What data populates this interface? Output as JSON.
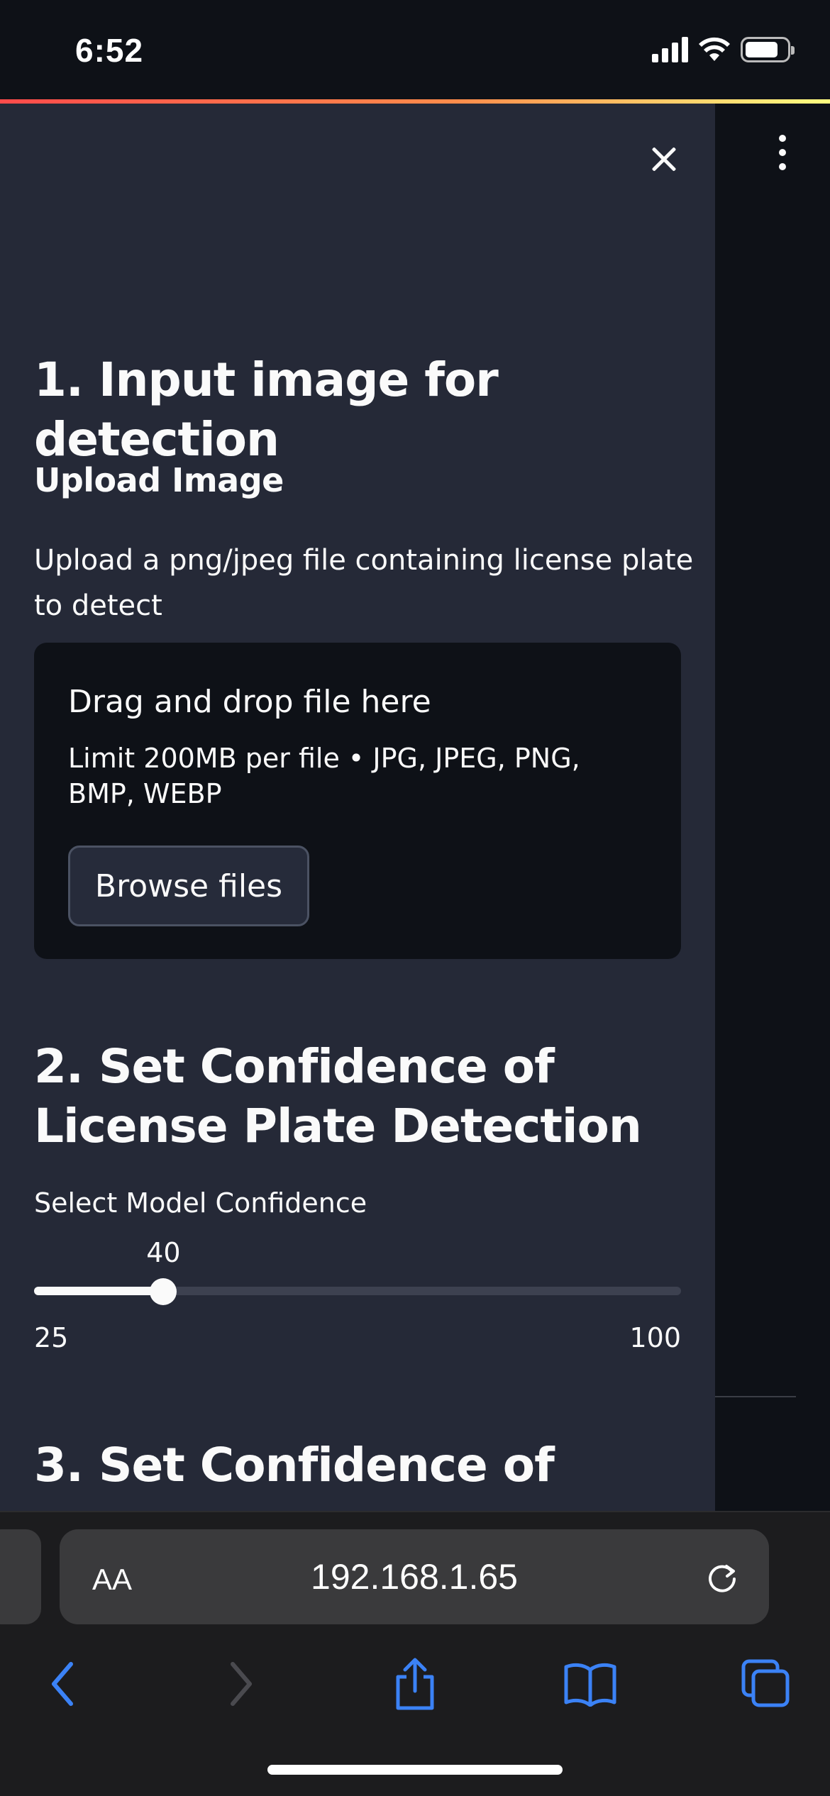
{
  "status_bar": {
    "time": "6:52"
  },
  "sidebar": {
    "section1_title": "1. Input image for detection",
    "upload_heading": "Upload Image",
    "upload_description": "Upload a png/jpeg file containing license plate to detect",
    "dropzone": {
      "title": "Drag and drop file here",
      "limit": "Limit 200MB per file • JPG, JPEG, PNG, BMP, WEBP",
      "browse_label": "Browse files"
    },
    "section2_title": "2. Set Confidence of License Plate Detection",
    "slider": {
      "label": "Select Model Confidence",
      "value": "40",
      "min": "25",
      "max": "100",
      "value_fraction": 0.2
    },
    "section3_title": "3. Set Confidence of"
  },
  "browser": {
    "text_size_label": "AA",
    "url": "192.168.1.65"
  },
  "colors": {
    "sidebar_bg": "#252937",
    "main_bg": "#0e1117",
    "accent_gradient_start": "#ff4b4b",
    "accent_gradient_end": "#fffd80",
    "safari_blue": "#3b82f6"
  },
  "icons": [
    "close-icon",
    "kebab-menu-icon",
    "reload-icon",
    "back-icon",
    "forward-icon",
    "share-icon",
    "bookmarks-icon",
    "tabs-icon"
  ]
}
